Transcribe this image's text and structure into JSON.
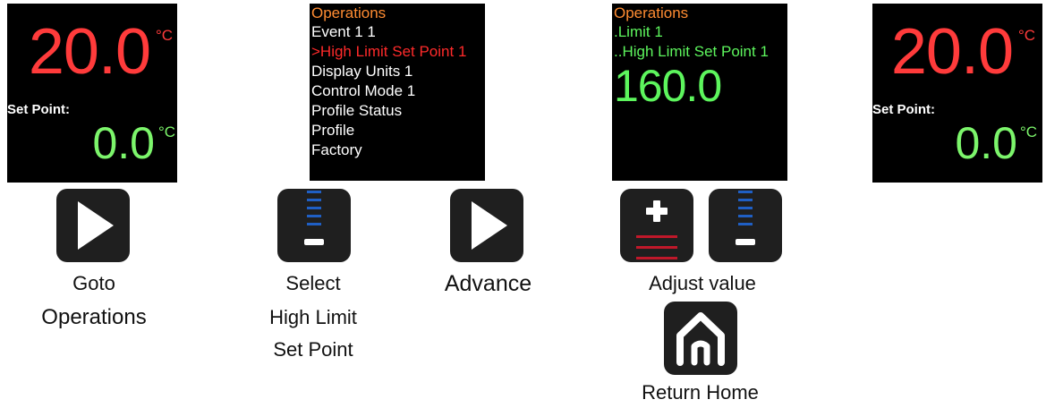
{
  "screen_home": {
    "temperature": "20.0",
    "unit": "°C",
    "set_point_label": "Set Point:",
    "set_point_value": "0.0"
  },
  "screen_operations": {
    "title": "Operations",
    "items": [
      "Event 1 1",
      ">High Limit Set Point 1",
      "Display Units 1",
      "Control Mode 1",
      "Profile Status",
      "Profile",
      "Factory"
    ]
  },
  "screen_limit": {
    "title": "Operations",
    "line1": ".Limit 1",
    "line2": "..High Limit Set Point 1",
    "value": "160.0"
  },
  "steps": {
    "goto": [
      "Goto",
      "Operations"
    ],
    "select": [
      "Select",
      "High Limit",
      "Set Point"
    ],
    "advance": "Advance",
    "adjust": "Adjust value",
    "home": "Return Home"
  },
  "icons": {
    "play": "play-icon",
    "down": "down-arrow-icon",
    "up": "up-arrow-icon",
    "home": "home-icon"
  },
  "colors": {
    "temperature": "#ff3b3b",
    "set_point": "#7cf56b",
    "menu_title": "#ff8c32",
    "menu_selected": "#ff2a2a",
    "value_green": "#5df55d",
    "button_bg": "#1f1f1f",
    "scale_blue": "#1f5fc4",
    "scale_red": "#c0182a"
  }
}
